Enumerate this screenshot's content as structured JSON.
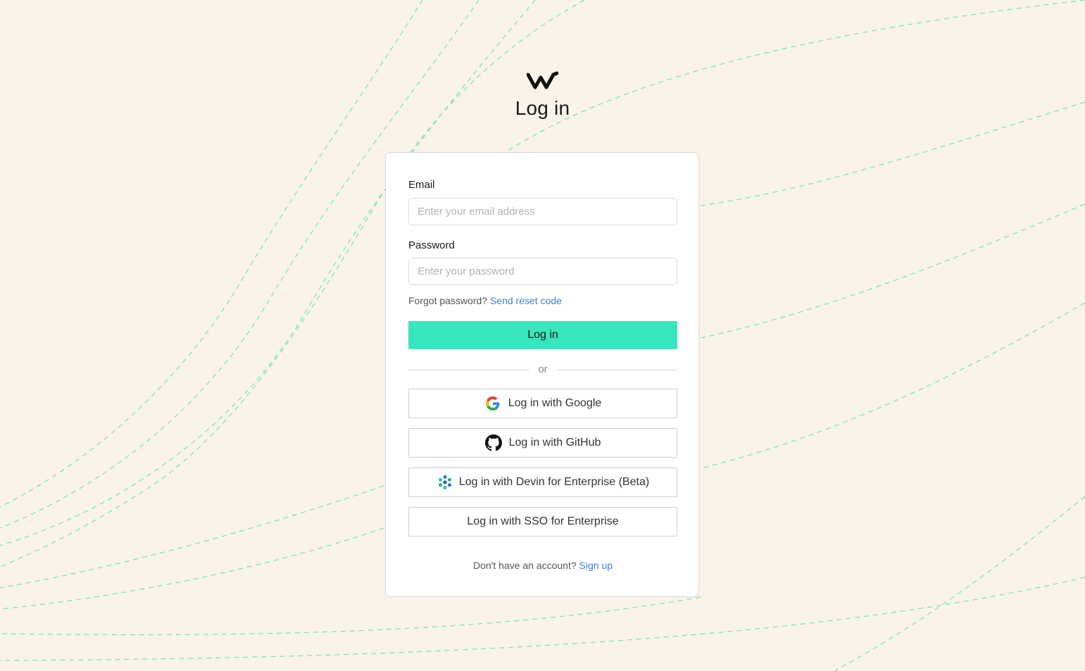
{
  "page": {
    "title": "Log in"
  },
  "form": {
    "email_label": "Email",
    "email_placeholder": "Enter your email address",
    "password_label": "Password",
    "password_placeholder": "Enter your password",
    "forgot_text": "Forgot password?",
    "reset_link": "Send reset code",
    "submit_label": "Log in",
    "divider_text": "or"
  },
  "oauth": {
    "google": "Log in with Google",
    "github": "Log in with GitHub",
    "devin": "Log in with Devin for Enterprise (Beta)",
    "sso": "Log in with SSO for Enterprise"
  },
  "footer": {
    "prompt": "Don't have an account?",
    "signup_link": "Sign up"
  },
  "icons": {
    "logo": "windsurf-logo-icon",
    "google": "google-icon",
    "github": "github-icon",
    "devin": "devin-icon"
  },
  "colors": {
    "background": "#f9f3ea",
    "accent": "#37e6bc",
    "link": "#3d7fe0",
    "decor_lines": "#6fe3b3"
  }
}
